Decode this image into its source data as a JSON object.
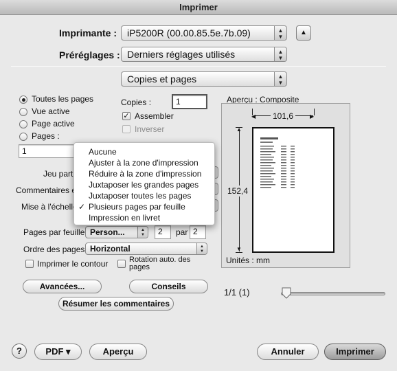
{
  "window": {
    "title": "Imprimer"
  },
  "printer": {
    "label": "Imprimante :",
    "value": "iP5200R (00.00.85.5e.7b.09)",
    "toggle_symbol": "▲"
  },
  "presets": {
    "label": "Préréglages :",
    "value": "Derniers réglages utilisés"
  },
  "panel": {
    "value": "Copies et pages"
  },
  "pages": {
    "options": [
      "Toutes les pages",
      "Vue active",
      "Page active",
      "Pages :"
    ],
    "selected_index": 0,
    "range_value": "1"
  },
  "copies": {
    "label": "Copies :",
    "value": "1",
    "collate_label": "Assembler",
    "collate_checked": true,
    "reverse_label": "Inverser",
    "reverse_checked": false
  },
  "left_labels": {
    "jeu": "Jeu partiel",
    "commentaires": "Commentaires et",
    "mise": "Mise à l'échelle",
    "pages_par_feuille": "Pages par feuille",
    "ordre": "Ordre des pages"
  },
  "pages_per_sheet": {
    "mode": "Person...",
    "cols": "2",
    "by_label": "par",
    "rows": "2"
  },
  "order": {
    "value": "Horizontal"
  },
  "outline": {
    "label": "Imprimer le contour",
    "checked": false
  },
  "auto_rotate": {
    "label_line1": "Rotation auto. des",
    "label_line2": "pages",
    "checked": false
  },
  "buttons": {
    "advanced": "Avancées...",
    "tips": "Conseils",
    "summarize": "Résumer les commentaires"
  },
  "preview": {
    "title": "Aperçu : Composite",
    "width": "101,6",
    "height": "152,4",
    "units": "Unités : mm",
    "page_count": "1/1 (1)",
    "zoom_level": 0.05
  },
  "scale_menu": {
    "items": [
      "Aucune",
      "Ajuster à la zone d'impression",
      "Réduire à la zone d'impression",
      "Juxtaposer les grandes pages",
      "Juxtaposer toutes les pages",
      "Plusieurs pages par feuille",
      "Impression en livret"
    ],
    "checked_index": 5,
    "check_mark": "✓"
  },
  "footer": {
    "help": "?",
    "pdf": "PDF ▾",
    "preview": "Aperçu",
    "cancel": "Annuler",
    "print": "Imprimer"
  }
}
